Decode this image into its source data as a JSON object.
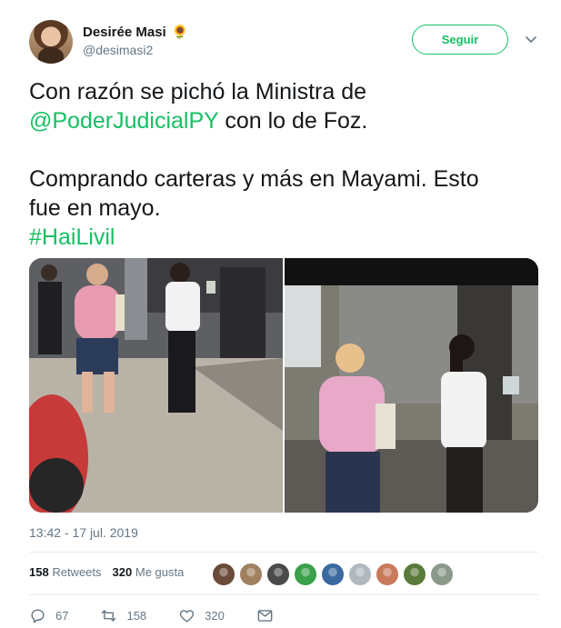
{
  "user": {
    "name": "Desirée Masi",
    "emoji": "🌻",
    "handle": "@desimasi2"
  },
  "follow": {
    "label": "Seguir"
  },
  "tweet": {
    "line1a": "Con razón se pichó la Ministra de",
    "mention": "@PoderJudicialPY",
    "line2b": " con lo de Foz.",
    "line3": "Comprando carteras y más en Mayami. Esto",
    "line4": "fue en mayo.",
    "hashtag": "#HaiLivil"
  },
  "timestamp": "13:42 - 17 jul. 2019",
  "stats": {
    "retweets_count": "158",
    "retweets_label": "Retweets",
    "likes_count": "320",
    "likes_label": "Me gusta"
  },
  "likers_colors": [
    "#6b4a3a",
    "#a08060",
    "#4a4a4a",
    "#3aa04a",
    "#3a6aa0",
    "#b0b8c0",
    "#c87a5a",
    "#5a7a3a",
    "#8a9a8a"
  ],
  "actions": {
    "reply_count": "67",
    "retweet_count": "158",
    "like_count": "320"
  },
  "colors": {
    "accent": "#17bf63",
    "text": "#14171a",
    "muted": "#657786"
  }
}
